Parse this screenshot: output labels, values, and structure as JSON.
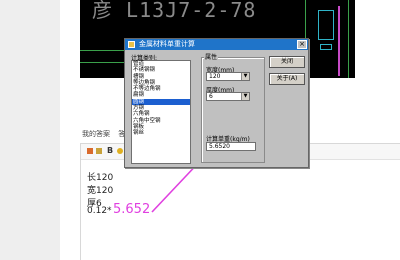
{
  "background": {
    "cad_text": "彦 L13J7-2-78"
  },
  "page": {
    "tabs": [
      "我的答案",
      "答案"
    ]
  },
  "editor": {
    "bold_label": "B",
    "lines": [
      "长120",
      "宽120",
      "厚6",
      "0.12*"
    ]
  },
  "annotation": {
    "value": "5.652",
    "color": "#e040e0"
  },
  "dialog": {
    "title": "金属材料单重计算",
    "close_symbol": "×",
    "category_label": "计算类别:",
    "categories": [
      "管道",
      "不锈钢钢",
      "槽钢",
      "等边角钢",
      "不等边角钢",
      "扁钢",
      "圆钢",
      "方钢",
      "六角钢",
      "六角中空钢",
      "钢板",
      "钢丝"
    ],
    "selected_index": 6,
    "group_label": "属性",
    "width_label": "宽度(mm)",
    "width_value": "120",
    "thickness_label": "厚度(mm)",
    "thickness_value": "6",
    "result_label": "计算单重(kg/m)",
    "result_value": "5.6520",
    "buttons": {
      "close": "关闭",
      "about": "关于(A)"
    },
    "titlebar_color": "#1f74c9",
    "selection_color": "#1c5fd0"
  }
}
